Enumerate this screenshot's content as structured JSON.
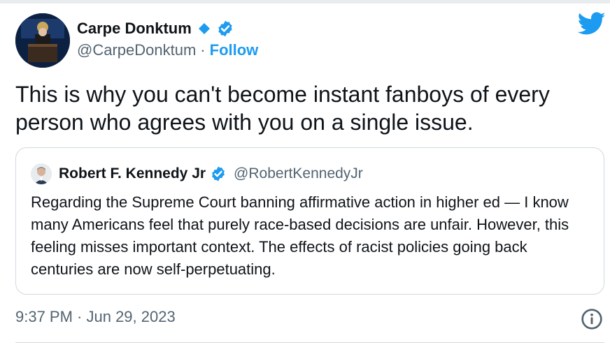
{
  "tweet": {
    "author_name": "Carpe Donktum",
    "author_handle": "@CarpeDonktum",
    "separator": "·",
    "follow_label": "Follow",
    "text": "This is why you can't become instant fanboys of every person who agrees with you on a single issue.",
    "timestamp": "9:37 PM · Jun 29, 2023",
    "icons": {
      "diamond": "blue-diamond-icon",
      "verified": "verified-badge-icon",
      "logo": "twitter-bird-icon",
      "info": "info-icon"
    }
  },
  "quoted_tweet": {
    "author_name": "Robert F. Kennedy Jr",
    "author_handle": "@RobertKennedyJr",
    "text": "Regarding the Supreme Court banning affirmative action in higher ed — I know many Americans feel that purely race-based decisions are unfair. However, this feeling misses important context. The effects of racist policies going back centuries are now self-perpetuating."
  },
  "colors": {
    "accent": "#1d9bf0",
    "text": "#0f1419",
    "secondary": "#536471",
    "border": "#cfd9de"
  }
}
